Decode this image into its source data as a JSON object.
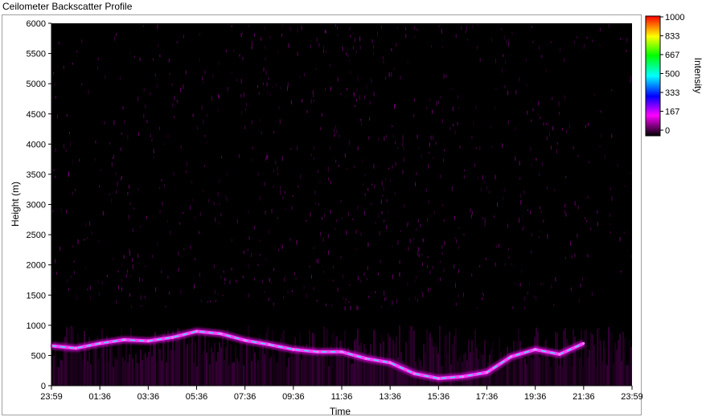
{
  "window": {
    "title": "Ceilometer Backscatter Profile"
  },
  "chart_data": {
    "type": "heatmap",
    "title": "",
    "xlabel": "Time",
    "ylabel": "Height (m)",
    "x_ticks": [
      "23:59",
      "01:36",
      "03:36",
      "05:36",
      "07:36",
      "09:36",
      "11:36",
      "13:36",
      "15:36",
      "17:36",
      "19:36",
      "21:36",
      "23:59"
    ],
    "y_ticks": [
      "0",
      "500",
      "1000",
      "1500",
      "2000",
      "2500",
      "3000",
      "3500",
      "4000",
      "4500",
      "5000",
      "5500",
      "6000"
    ],
    "ylim": [
      0,
      6000
    ],
    "colorbar": {
      "label": "Intensity",
      "ticks": [
        "0",
        "167",
        "333",
        "500",
        "667",
        "833",
        "1000"
      ],
      "range": [
        0,
        1000
      ],
      "colors": [
        "#000000",
        "#ff00ff",
        "#0000ff",
        "#00ffff",
        "#00ff00",
        "#ffff00",
        "#ff0000"
      ]
    },
    "layer_trace": {
      "description_units": "hours since start vs height m",
      "hours": [
        0,
        1,
        2,
        3,
        4,
        5,
        6,
        7,
        8,
        9,
        10,
        11,
        12,
        13,
        14,
        15,
        16,
        17,
        18,
        19,
        20,
        21,
        22
      ],
      "height_m": [
        660,
        620,
        700,
        760,
        740,
        800,
        900,
        860,
        750,
        680,
        600,
        560,
        560,
        450,
        380,
        200,
        120,
        150,
        220,
        480,
        600,
        520,
        700
      ]
    }
  }
}
